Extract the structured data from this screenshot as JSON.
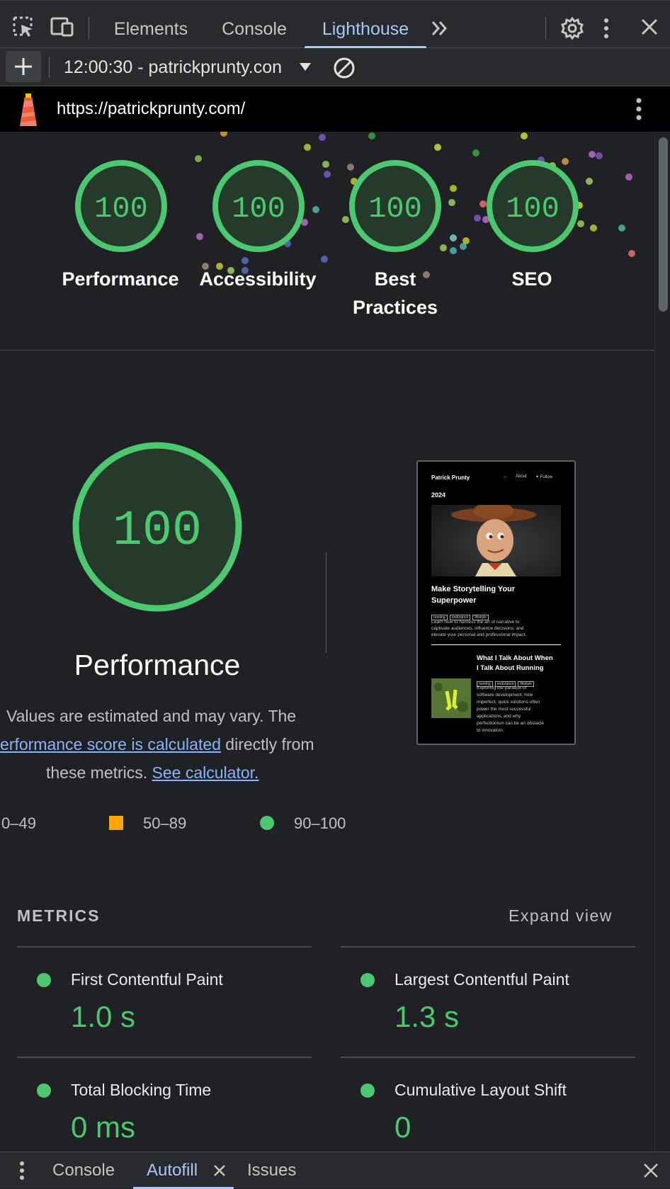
{
  "toolbar": {
    "tabs": [
      {
        "label": "Elements"
      },
      {
        "label": "Console"
      },
      {
        "label": "Lighthouse"
      }
    ],
    "more_tabs": "»",
    "icons": [
      "inspect-element-icon",
      "device-toolbar-icon",
      "more-tabs-icon",
      "settings-gear-icon",
      "more-vertical-icon",
      "close-icon"
    ]
  },
  "report_bar": {
    "new_report_icon": "plus-icon",
    "report_label": "12:00:30 - patrickprunty.con",
    "dropdown_icon": "triangle-down-icon",
    "clear_icon": "block-icon"
  },
  "url_bar": {
    "url": "https://patrickprunty.com/",
    "logo": "lighthouse-logo",
    "menu_icon": "more-vertical-icon"
  },
  "scores": [
    {
      "label": "Performance",
      "score": "100"
    },
    {
      "label": "Accessibility",
      "score": "100"
    },
    {
      "label": "Best",
      "label2": "Practices",
      "score": "100"
    },
    {
      "label": "SEO",
      "score": "100"
    }
  ],
  "performance": {
    "score": "100",
    "title": "Performance",
    "desc_line1": "Values are estimated and may vary. The",
    "desc_link1": "erformance score is calculated",
    "desc_line2_rest": " directly from",
    "desc_line3": "these metrics.",
    "desc_link2": "See calculator.",
    "legend": [
      {
        "range": "0–49",
        "color": "#ff4e42"
      },
      {
        "range": "50–89",
        "color": "#ffa400"
      },
      {
        "range": "90–100",
        "color": "#4cc870"
      }
    ]
  },
  "thumbnail": {
    "site_name": "Patrick Prunty",
    "nav_about": "About",
    "nav_follow": "Follow",
    "year": "2024",
    "post1_title_line1": "Make Storytelling Your",
    "post1_title_line2": "Superpower",
    "post1_tags": [
      "running",
      "endurance",
      "lifestyle"
    ],
    "post1_desc_line1": "Learn how to harness the art of narrative to",
    "post1_desc_line2": "captivate audiences, influence decisions, and",
    "post1_desc_line3": "elevate your personal and professional impact.",
    "post2_title_line1": "What I Talk About When",
    "post2_title_line2": "I Talk About Running",
    "post2_tags": [
      "running",
      "endurance",
      "lifestyle"
    ],
    "post2_desc": [
      "Exploring the paradox of",
      "software development: how",
      "imperfect, quick solutions often",
      "power the most successful",
      "applications, and why",
      "perfectionism can be an obstacle",
      "to innovation."
    ]
  },
  "metrics": {
    "title": "METRICS",
    "expand": "Expand view",
    "items": [
      {
        "name": "First Contentful Paint",
        "value": "1.0 s"
      },
      {
        "name": "Largest Contentful Paint",
        "value": "1.3 s"
      },
      {
        "name": "Total Blocking Time",
        "value": "0 ms"
      },
      {
        "name": "Cumulative Layout Shift",
        "value": "0"
      }
    ]
  },
  "drawer": {
    "tabs": [
      {
        "label": "Console"
      },
      {
        "label": "Autofill"
      },
      {
        "label": "Issues"
      }
    ]
  },
  "colors": {
    "pass": "#4cc870",
    "accent": "#a8c7fa",
    "background": "#202124",
    "link": "#8ab4f8"
  }
}
